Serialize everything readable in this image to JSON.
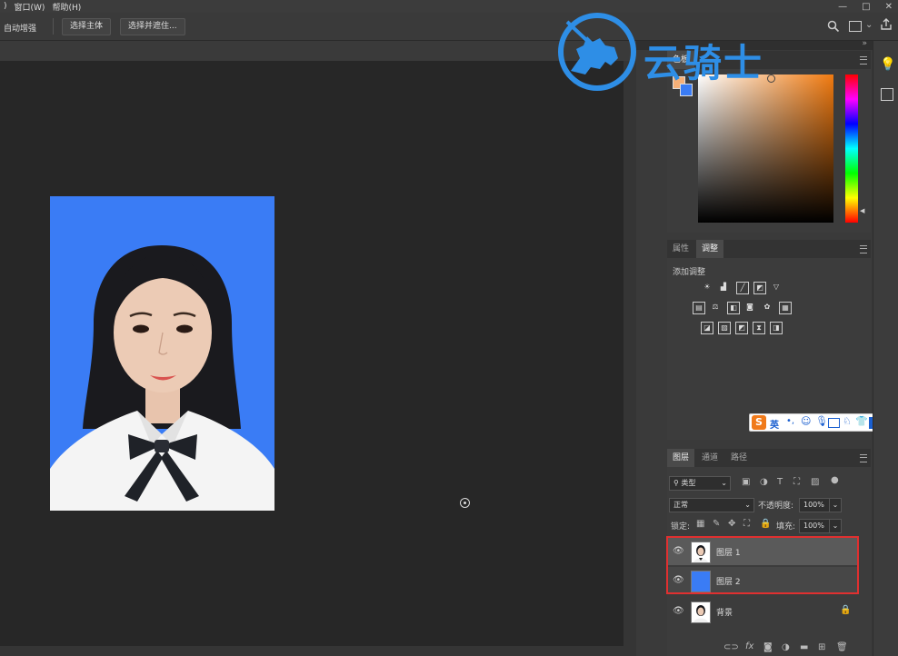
{
  "menubar": {
    "items": [
      ")",
      "窗口(W)",
      "帮助(H)"
    ]
  },
  "window_controls": {
    "minimize": "—",
    "maximize": "□",
    "close": "✕"
  },
  "options": {
    "auto_label": "自动增强",
    "select_subject": "选择主体",
    "select_mask": "选择并遮住...",
    "collapse": "»"
  },
  "watermark": {
    "text": "云骑士"
  },
  "color_panel": {
    "tab_label": "色板"
  },
  "adjust_panel": {
    "tabs": [
      "属性",
      "调整"
    ],
    "add_label": "添加调整"
  },
  "ime_bar": {
    "label": "英"
  },
  "layers_panel": {
    "tabs": [
      "图层",
      "通道",
      "路径"
    ],
    "filter_label": "类型",
    "blend_mode": "正常",
    "opacity_label": "不透明度:",
    "opacity_value": "100%",
    "lock_label": "锁定:",
    "fill_label": "填充:",
    "fill_value": "100%",
    "layers": [
      {
        "name": "图层 1"
      },
      {
        "name": "图层 2"
      },
      {
        "name": "背景"
      }
    ]
  },
  "colors": {
    "canvas_bg": "#272727",
    "photo_bg": "#3a7cf5",
    "highlight": "#e03030",
    "foreground_swatch": "#f5b078",
    "background_swatch": "#3a7cf5"
  }
}
